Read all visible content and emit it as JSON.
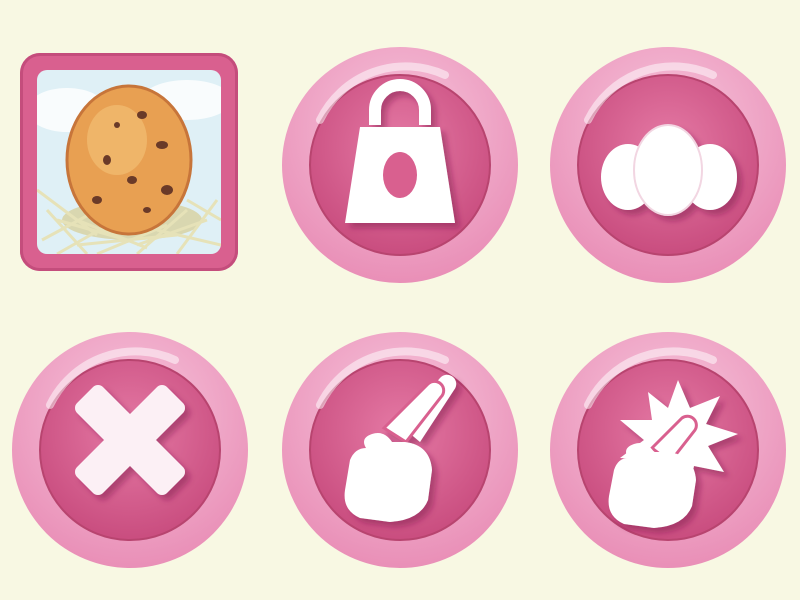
{
  "icons": [
    {
      "id": "egg-tile",
      "icon": "egg-in-nest-icon"
    },
    {
      "id": "shop-button",
      "icon": "shopping-bag-egg-icon"
    },
    {
      "id": "eggs-button",
      "icon": "three-eggs-icon"
    },
    {
      "id": "close-button",
      "icon": "close-x-icon"
    },
    {
      "id": "swipe-button",
      "icon": "two-finger-swipe-icon"
    },
    {
      "id": "tap-button",
      "icon": "tap-burst-icon"
    }
  ],
  "colors": {
    "background": "#f8f8e3",
    "button_outer": "#f0a9c8",
    "button_inner": "#d9608f",
    "tile_frame": "#d9608f",
    "glyph": "#ffffff",
    "egg": "#e8a052"
  }
}
